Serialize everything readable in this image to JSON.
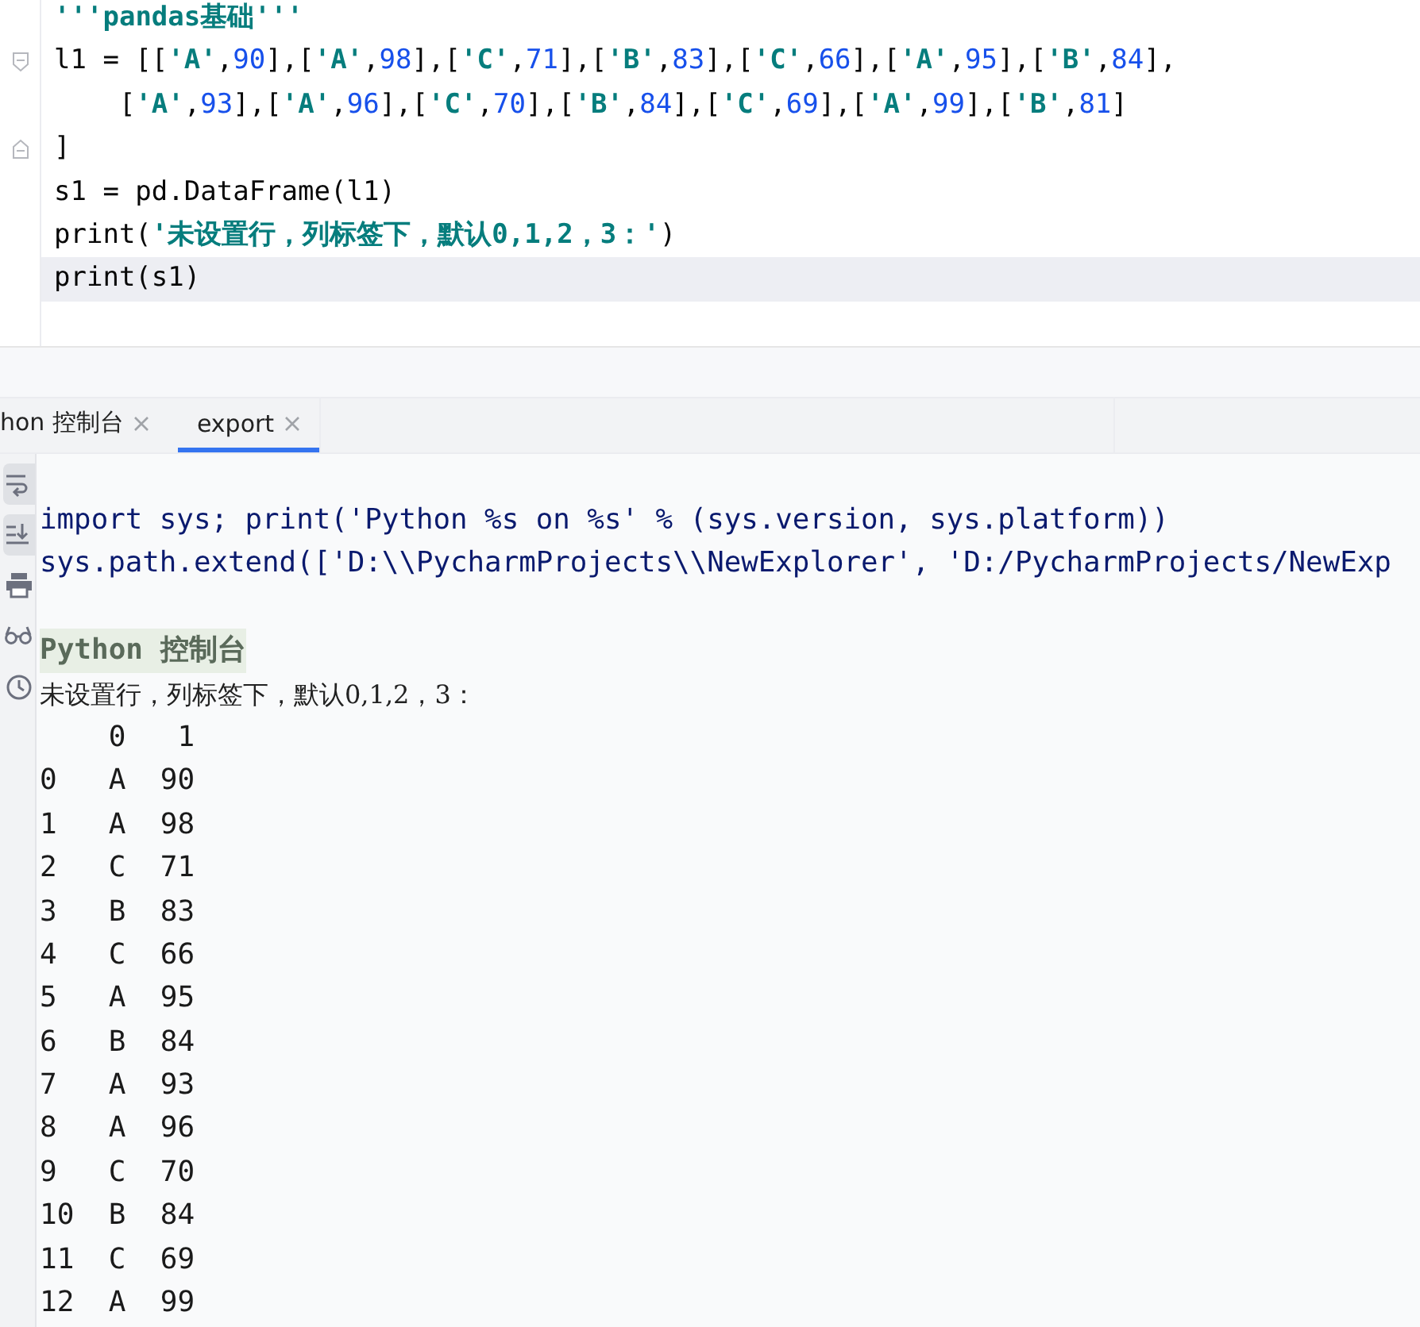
{
  "editor": {
    "lines": [
      {
        "text": "'''pandas基础'''",
        "fold_start": false,
        "fold_end": false,
        "current": false
      },
      {
        "text": "l1 = [['A',90],['A',98],['C',71],['B',83],['C',66],['A',95],['B',84],",
        "fold_start": true,
        "fold_end": false,
        "current": false
      },
      {
        "text": "    ['A',93],['A',96],['C',70],['B',84],['C',69],['A',99],['B',81]",
        "fold_start": false,
        "fold_end": false,
        "current": false
      },
      {
        "text": "]",
        "fold_start": false,
        "fold_end": true,
        "current": false
      },
      {
        "text": "s1 = pd.DataFrame(l1)",
        "fold_start": false,
        "fold_end": false,
        "current": false
      },
      {
        "text": "print('未设置行，列标签下，默认0,1,2，3：')",
        "fold_start": false,
        "fold_end": false,
        "current": false
      },
      {
        "text": "print(s1)",
        "fold_start": false,
        "fold_end": false,
        "current": true
      }
    ]
  },
  "console": {
    "tabs": [
      {
        "label": "hon 控制台",
        "selected": false
      },
      {
        "label": "export",
        "selected": true
      }
    ],
    "toolbar": [
      {
        "kind": "soft-wrap",
        "on": true
      },
      {
        "kind": "scroll-end",
        "on": true
      },
      {
        "kind": "print",
        "on": false
      },
      {
        "kind": "glasses",
        "on": false
      },
      {
        "kind": "history",
        "on": false
      }
    ],
    "lines": [
      {
        "kind": "command",
        "text": "import sys; print('Python %s on %s' % (sys.version, sys.platform))"
      },
      {
        "kind": "command",
        "text": "sys.path.extend(['D:\\\\PycharmProjects\\\\NewExplorer', 'D:/PycharmProjects/NewExp"
      },
      {
        "kind": "banner",
        "text": "Python 控制台"
      },
      {
        "kind": "cjk",
        "text": "未设置行，列标签下，默认0,1,2，3："
      },
      {
        "kind": "output",
        "text": "    0   1"
      },
      {
        "kind": "output",
        "text": "0   A  90"
      },
      {
        "kind": "output",
        "text": "1   A  98"
      },
      {
        "kind": "output",
        "text": "2   C  71"
      },
      {
        "kind": "output",
        "text": "3   B  83"
      },
      {
        "kind": "output",
        "text": "4   C  66"
      },
      {
        "kind": "output",
        "text": "5   A  95"
      },
      {
        "kind": "output",
        "text": "6   B  84"
      },
      {
        "kind": "output",
        "text": "7   A  93"
      },
      {
        "kind": "output",
        "text": "8   A  96"
      },
      {
        "kind": "output",
        "text": "9   C  70"
      },
      {
        "kind": "output",
        "text": "10  B  84"
      },
      {
        "kind": "output",
        "text": "11  C  69"
      },
      {
        "kind": "output",
        "text": "12  A  99"
      }
    ]
  }
}
